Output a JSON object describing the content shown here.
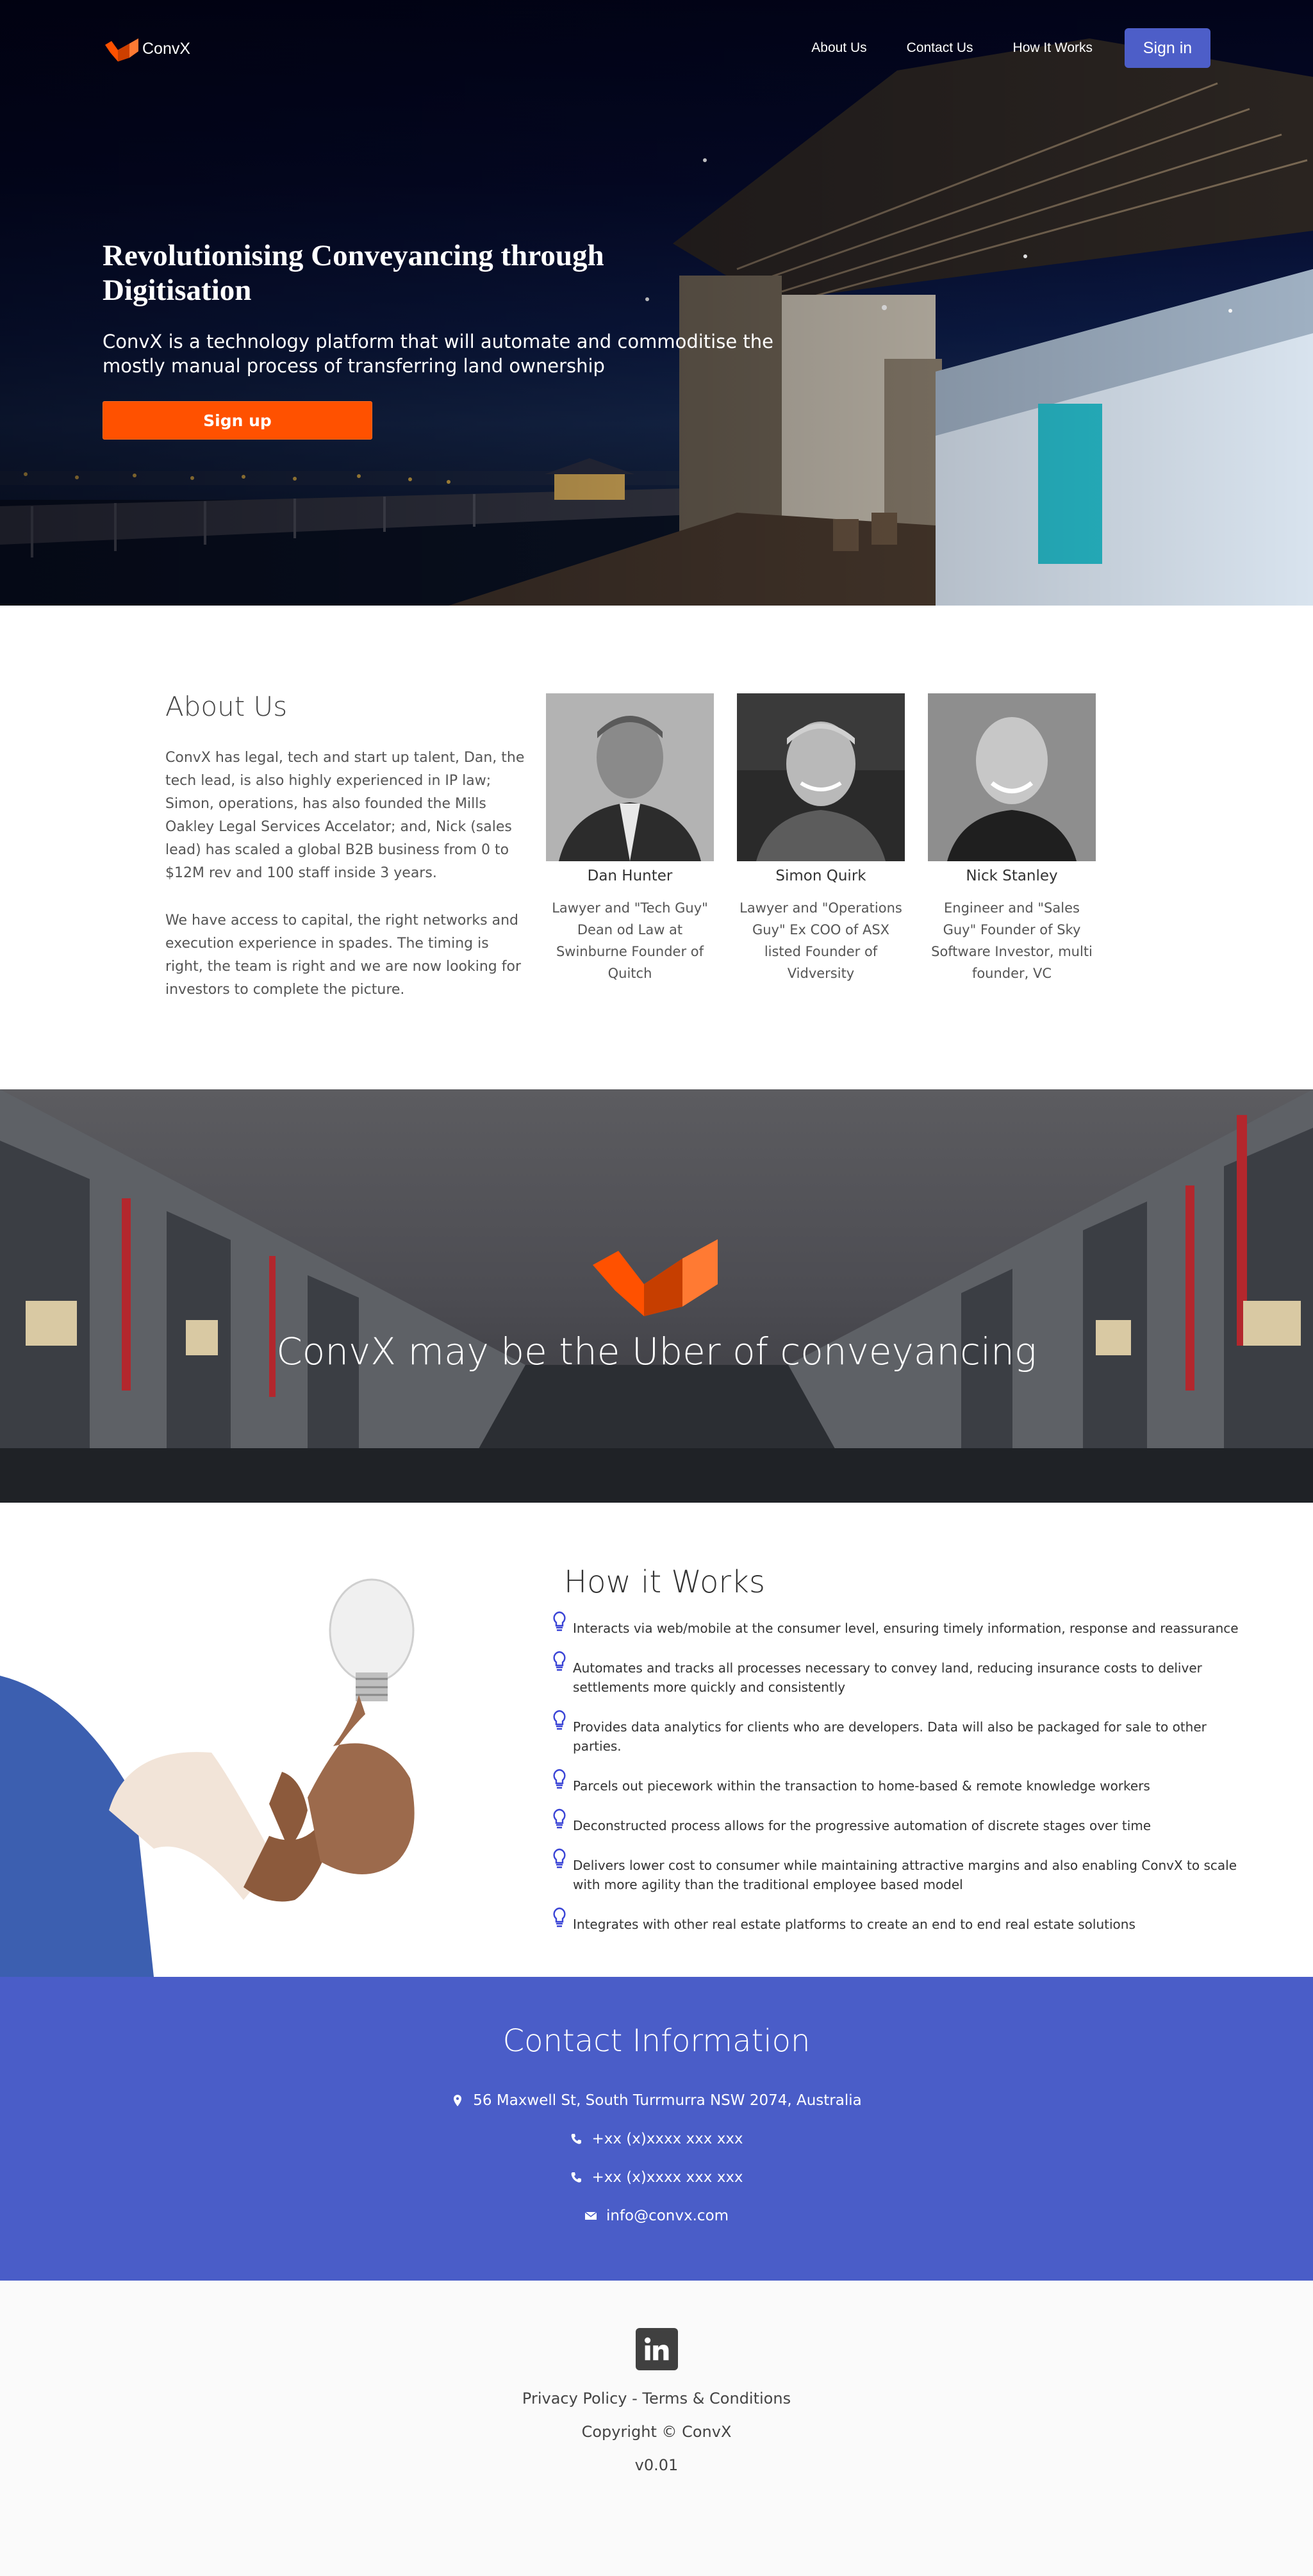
{
  "brand": {
    "name": "ConvX",
    "accent": "#ff5100",
    "primary": "#4a5dc8"
  },
  "nav": {
    "links": [
      "About Us",
      "Contact Us",
      "How It Works"
    ],
    "signin_label": "Sign in"
  },
  "hero": {
    "title": "Revolutionising Conveyancing through Digitisation",
    "subtitle": "ConvX is a technology platform that will automate and commoditise the mostly manual process of transferring land ownership",
    "cta_label": "Sign up"
  },
  "about": {
    "title": "About Us",
    "paragraphs": [
      "ConvX has legal, tech and start up talent, Dan, the tech lead, is also highly experienced in IP law; Simon, operations, has also founded the Mills Oakley Legal Services Accelator; and, Nick (sales lead) has scaled a global B2B business from 0 to $12M rev and 100 staff inside 3 years.",
      "We have access to capital, the right networks and execution experience in spades. The timing is right, the team is right and we are now looking for investors to complete the picture."
    ],
    "team": [
      {
        "name": "Dan Hunter",
        "bio": "Lawyer and \"Tech Guy\" Dean od Law at Swinburne Founder of Quitch"
      },
      {
        "name": "Simon Quirk",
        "bio": "Lawyer and \"Operations Guy\" Ex COO of ASX listed Founder of Vidversity"
      },
      {
        "name": "Nick Stanley",
        "bio": "Engineer and \"Sales Guy\" Founder of Sky Software Investor, multi founder, VC"
      }
    ]
  },
  "banner": {
    "text": "ConvX may be the Uber of conveyancing"
  },
  "how": {
    "title": "How it Works",
    "icon": "lightbulb-icon",
    "items": [
      "Interacts via web/mobile at the consumer level, ensuring timely information, response and reassurance",
      " Automates and tracks all processes necessary to convey land, reducing insurance costs to deliver settlements more quickly and consistently",
      "Provides data analytics for clients who are developers. Data will also be packaged for sale to other parties.",
      "Parcels out piecework within the transaction to home-based & remote knowledge workers",
      "Deconstructed process allows for the progressive automation of discrete stages over time",
      "Delivers lower cost to consumer while maintaining attractive margins and also enabling ConvX to scale with more agility than the traditional employee based model",
      "Integrates with other real estate platforms to create an end to end real estate solutions"
    ]
  },
  "contact": {
    "title": "Contact Information",
    "address": "56 Maxwell St, South Turrmurra NSW 2074, Australia",
    "phones": [
      "+xx (x)xxxx xxx xxx",
      "+xx (x)xxxx xxx xxx"
    ],
    "email": "info@convx.com"
  },
  "footer": {
    "privacy": "Privacy Policy",
    "separator": " - ",
    "terms": "Terms & Conditions",
    "copyright": "Copyright © ConvX",
    "version": "v0.01",
    "social_icon": "linkedin-icon"
  }
}
